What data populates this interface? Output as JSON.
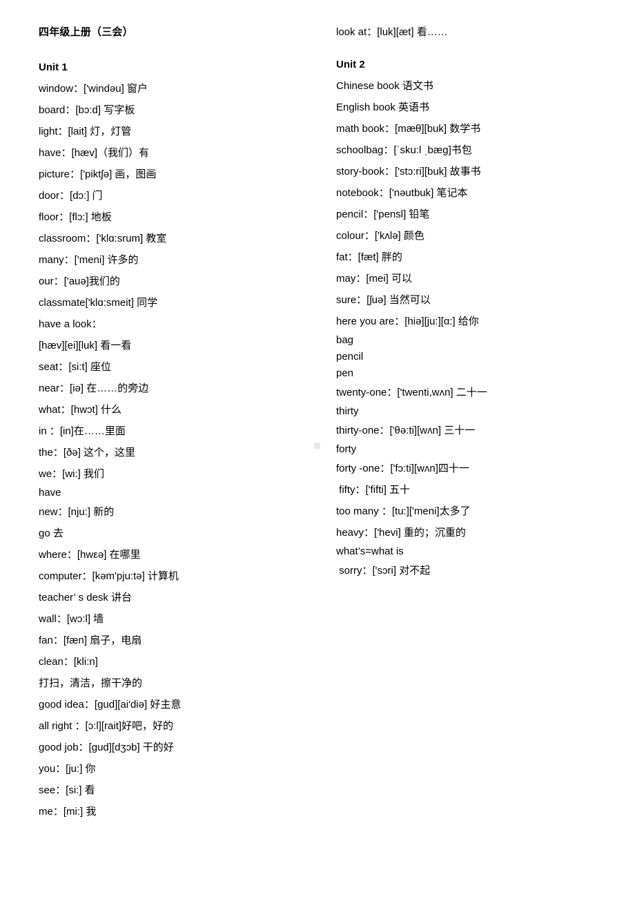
{
  "document": {
    "title": "四年级上册（三会）",
    "background_color": "#ffffff",
    "text_color": "#000000",
    "marker_color": "#e8e8e8"
  },
  "left_column": {
    "title": "四年级上册（三会）",
    "unit_heading": "Unit 1",
    "entries": [
      {
        "text": "window：['windəu] 窗户",
        "compact": false
      },
      {
        "text": "board：[bɔ:d] 写字板",
        "compact": false
      },
      {
        "text": "light：[lait] 灯，灯管",
        "compact": false
      },
      {
        "text": "have：[hæv]（我们）有",
        "compact": false
      },
      {
        "text": "picture：['piktʃə] 画，图画",
        "compact": false
      },
      {
        "text": "door：[dɔ:] 门",
        "compact": false
      },
      {
        "text": "floor：[flɔ:] 地板",
        "compact": false
      },
      {
        "text": "classroom：['klɑ:srum] 教室",
        "compact": false
      },
      {
        "text": "many：['meni] 许多的",
        "compact": false
      },
      {
        "text": "our：['auə]我们的",
        "compact": false
      },
      {
        "text": "classmate['klɑ:smeit] 同学",
        "compact": false
      },
      {
        "text": "have a look：",
        "compact": false
      },
      {
        "text": "[hæv][ei][luk] 看一看",
        "compact": false
      },
      {
        "text": "seat：[si:t] 座位",
        "compact": false
      },
      {
        "text": "near：[iə] 在……的旁边",
        "compact": false
      },
      {
        "text": "what：[hwɔt] 什么",
        "compact": false
      },
      {
        "text": "in ：[in]在……里面",
        "compact": false
      },
      {
        "text": "the：[ðə] 这个，这里",
        "compact": false
      },
      {
        "text": "we：[wi:] 我们",
        "compact": false
      },
      {
        "text": "have",
        "compact": true
      },
      {
        "text": "new：[nju:] 新的",
        "compact": false
      },
      {
        "text": "go 去",
        "compact": false
      },
      {
        "text": "where：[hwεə] 在哪里",
        "compact": false
      },
      {
        "text": "computer：[kəm'pju:tə] 计算机",
        "compact": false
      },
      {
        "text": "teacher’ s desk 讲台",
        "compact": false
      },
      {
        "text": "wall：[wɔ:l] 墙",
        "compact": false
      },
      {
        "text": "fan：[fæn] 扇子，电扇",
        "compact": false
      },
      {
        "text": "clean：[kli:n]",
        "compact": false
      },
      {
        "text": "打扫，清洁，擦干净的",
        "compact": false
      },
      {
        "text": "good idea：[gud][ai'diə] 好主意",
        "compact": false
      },
      {
        "text": "all right ：[ɔ:l][rait]好吧，好的",
        "compact": false
      },
      {
        "text": "good job：[gud][dʒɔb] 干的好",
        "compact": false
      },
      {
        "text": "you：[ju:] 你",
        "compact": false
      },
      {
        "text": "see：[si:] 看",
        "compact": false
      },
      {
        "text": "me：[mi:] 我",
        "compact": false
      }
    ]
  },
  "right_column": {
    "lead_entry": "look at：[luk][æt] 看……",
    "unit_heading": "Unit 2",
    "entries": [
      {
        "text": "Chinese book 语文书",
        "compact": false
      },
      {
        "text": "English book 英语书",
        "compact": false
      },
      {
        "text": "math book：[mæθ][buk] 数学书",
        "compact": false
      },
      {
        "text": "schoolbag：[ˈsku:l ˌbæg]书包",
        "compact": false
      },
      {
        "text": "story-book：['stɔ:ri][buk] 故事书",
        "compact": false
      },
      {
        "text": "notebook：['nəutbuk] 笔记本",
        "compact": false
      },
      {
        "text": "pencil：['pensl] 铅笔",
        "compact": false
      },
      {
        "text": "colour：['kʌlə] 颜色",
        "compact": false
      },
      {
        "text": "fat：[fæt] 胖的",
        "compact": false
      },
      {
        "text": "may：[mei] 可以",
        "compact": false
      },
      {
        "text": "sure：[ʃuə] 当然可以",
        "compact": false
      },
      {
        "text": "here you are：[hiə][ju:][ɑ:] 给你",
        "compact": false
      },
      {
        "text": "bag",
        "compact": true
      },
      {
        "text": "pencil",
        "compact": true
      },
      {
        "text": "pen",
        "compact": true
      },
      {
        "text": "twenty-one：['twenti,wʌn] 二十一",
        "compact": false
      },
      {
        "text": "thirty",
        "compact": true
      },
      {
        "text": "thirty-one：['θə:ti][wʌn] 三十一",
        "compact": false
      },
      {
        "text": "forty",
        "compact": true
      },
      {
        "text": "forty -one：['fɔ:ti][wʌn]四十一",
        "compact": false
      },
      {
        "text": " fifty：['fifti] 五十",
        "compact": false
      },
      {
        "text": "too many ：[tu:]['meni]太多了",
        "compact": false
      },
      {
        "text": "heavy：['hevi] 重的；沉重的",
        "compact": false
      },
      {
        "text": "what’s=what is",
        "compact": true
      },
      {
        "text": " sorry：['sɔri] 对不起",
        "compact": false
      }
    ]
  }
}
